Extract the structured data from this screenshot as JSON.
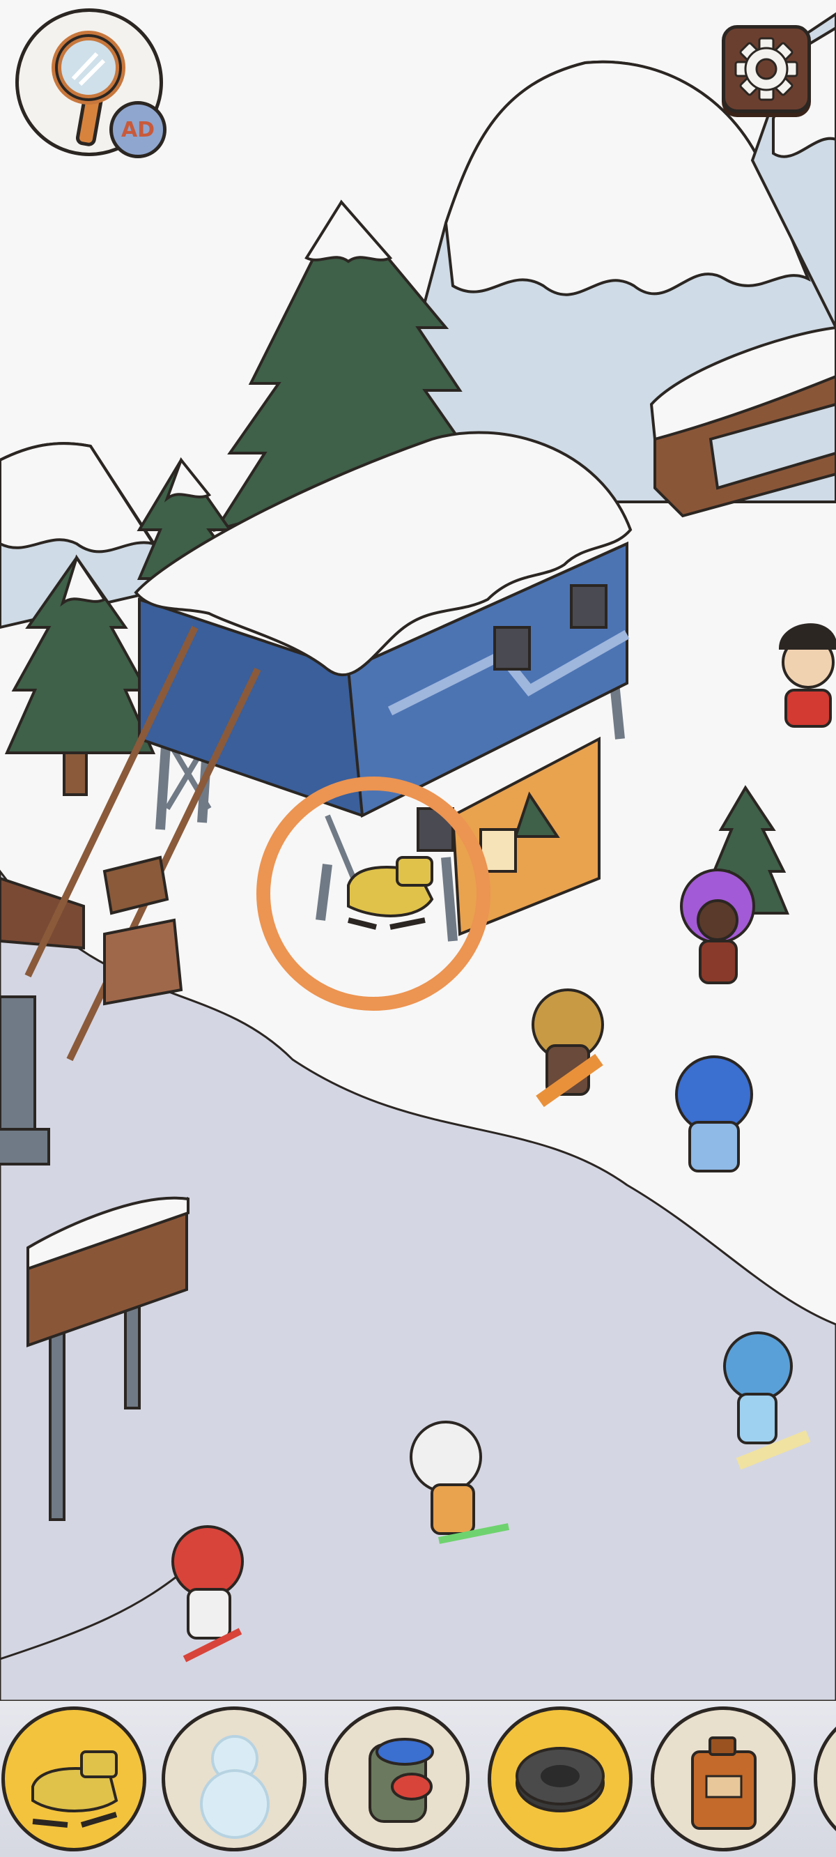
{
  "hud": {
    "hint_button": {
      "badge_label": "AD",
      "icon": "magnifier-icon"
    },
    "settings_button": {
      "icon": "gear-icon"
    }
  },
  "scene": {
    "name": "ski-resort",
    "highlight": {
      "target": "snowmobile",
      "ring_color": "#ec9451"
    },
    "colors": {
      "snow": "#f7f7f7",
      "slope_shadow": "#d4d6e3",
      "mountain_blue": "#cfdbe6",
      "pine": "#3f6049",
      "lift_station_blue": "#3a5f9b",
      "wood": "#7a4a34"
    }
  },
  "find_bar": {
    "items": [
      {
        "name": "snowmobile",
        "status": "found"
      },
      {
        "name": "snowman",
        "status": "pending"
      },
      {
        "name": "backpack",
        "status": "pending"
      },
      {
        "name": "tire",
        "status": "found"
      },
      {
        "name": "fuel-can",
        "status": "pending"
      }
    ],
    "found_color": "#f3c33d",
    "pending_color": "#e9dfcd"
  }
}
